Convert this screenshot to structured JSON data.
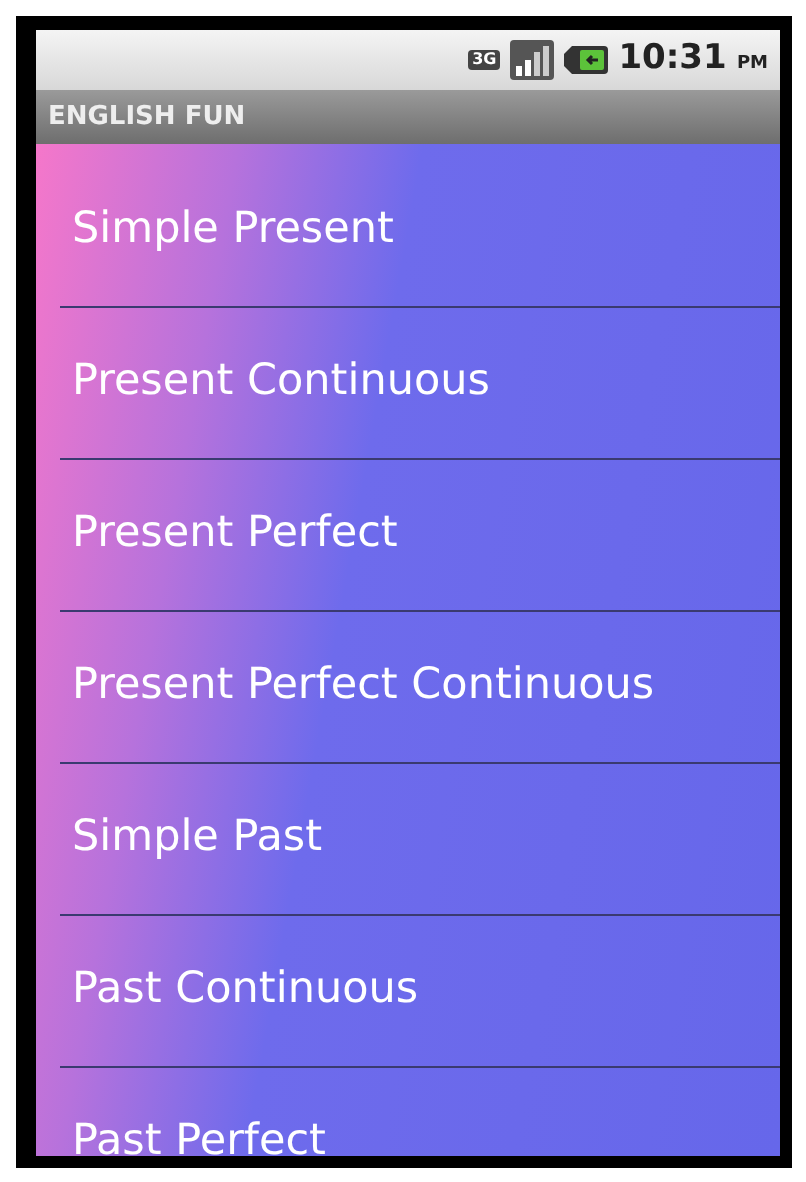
{
  "status_bar": {
    "network": "3G",
    "time": "10:31",
    "period": "PM"
  },
  "title_bar": {
    "title": "ENGLISH FUN"
  },
  "list": [
    {
      "label": "Simple Present"
    },
    {
      "label": "Present Continuous"
    },
    {
      "label": "Present Perfect"
    },
    {
      "label": "Present Perfect Continuous"
    },
    {
      "label": "Simple Past"
    },
    {
      "label": "Past Continuous"
    },
    {
      "label": "Past Perfect"
    }
  ]
}
